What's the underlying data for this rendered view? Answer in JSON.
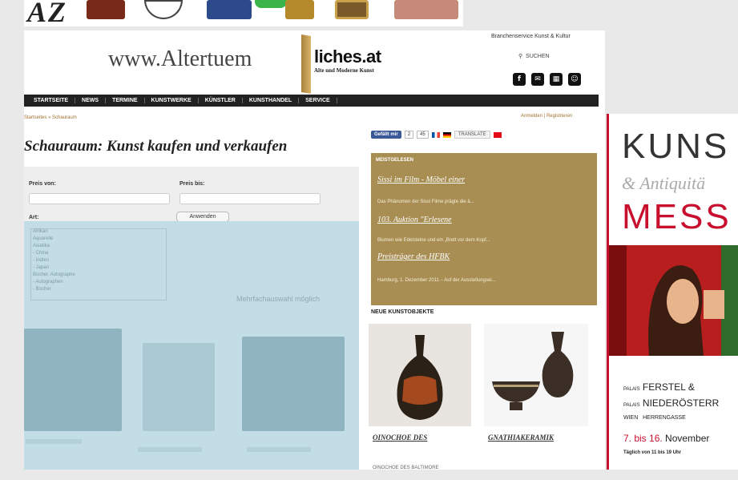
{
  "top_banner": {
    "logo_letters": "AZ"
  },
  "header": {
    "site_name_left": "www.Altertuem",
    "site_name_right": "liches.at",
    "tagline": "Alte und Moderne Kunst",
    "service_label": "Branchenservice Kunst & Kultur",
    "search_label": "SUCHEN"
  },
  "nav": [
    "STARTSEITE",
    "NEWS",
    "TERMINE",
    "KUNSTWERKE",
    "KÜNSTLER",
    "KUNSTHANDEL",
    "SERVICE"
  ],
  "breadcrumb": {
    "home": "Startseites",
    "sep": "»",
    "current": "Schauraum"
  },
  "account": {
    "login": "Anmelden",
    "sep": "|",
    "register": "Registrieren"
  },
  "page_title": "Schauraum: Kunst kaufen und verkaufen",
  "filter": {
    "price_from_label": "Preis von:",
    "price_to_label": "Preis bis:",
    "apply_label": "Anwenden",
    "art_label": "Art:",
    "art_options": [
      "Afrikan",
      "Aquarelle",
      "Asiatika",
      "- China",
      "- Indien",
      "- Japan",
      "Bücher, Autographe",
      "- Autographen",
      "- Bücher"
    ],
    "multi_hint": "Mehrfachauswahl möglich"
  },
  "social": {
    "like_label": "Gefällt mir",
    "like_count": "2",
    "gplus_count": "45",
    "translate_label": "TRANSLATE"
  },
  "meistgelesen": {
    "heading": "MEISTGELESEN",
    "items": [
      {
        "title": "Sissi im Film - Möbel einer",
        "teaser": "Das Phänomen der Sissi Filme prägte die ä..."
      },
      {
        "title": "103. Auktion \"Erlesene",
        "teaser": "Blumen wie Edelsteine und ein „Brett vor dem Kopf..."
      },
      {
        "title": "Preisträger des HFBK",
        "teaser": "Hamburg, 1. Dezember 2011 – Auf der Ausstellungsei..."
      }
    ]
  },
  "neue": {
    "heading": "NEUE KUNSTOBJEKTE",
    "items": [
      {
        "caption": "OINOCHOE DES"
      },
      {
        "caption": "GNATHIAKERAMIK"
      }
    ],
    "third_caption": "OINOCHOE DES BALTIMORE"
  },
  "ad": {
    "line1": "KUNS",
    "line2": "& Antiquitä",
    "line3": "MESS",
    "venue1_prefix": "PALAIS",
    "venue1": "FERSTEL &",
    "venue2_prefix": "PALAIS",
    "venue2": "NIEDERÖSTERR",
    "city": "WIEN",
    "street": "HERRENGASSE",
    "date_red": "7. bis 16.",
    "date_month": "November",
    "hours": "Täglich von 11 bis 19 Uhr"
  },
  "colors": {
    "nav_bg": "#222222",
    "meist_bg": "#a88e53",
    "overlay": "#c3dde6",
    "ad_red": "#c8102e",
    "facebook": "#3b5998"
  },
  "icons": [
    "search-icon",
    "facebook-icon",
    "email-icon",
    "grid-icon",
    "user-icon"
  ]
}
